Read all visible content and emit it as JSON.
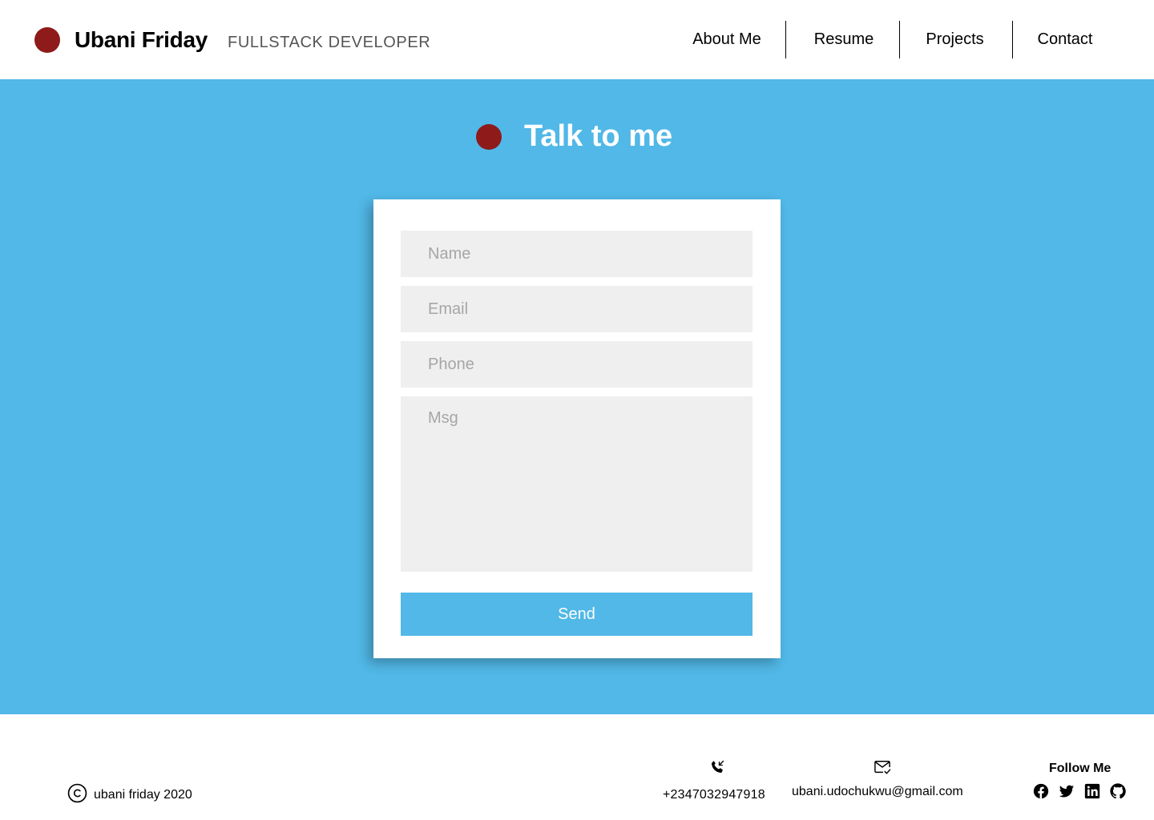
{
  "colors": {
    "accent_red": "#8e1a1a",
    "accent_blue": "#51b8e7"
  },
  "header": {
    "name": "Ubani Friday",
    "role": "FULLSTACK DEVELOPER",
    "nav": [
      {
        "label": "About Me"
      },
      {
        "label": "Resume"
      },
      {
        "label": "Projects"
      },
      {
        "label": "Contact"
      }
    ]
  },
  "contact_section": {
    "title": "Talk to me",
    "form": {
      "name_placeholder": "Name",
      "email_placeholder": "Email",
      "phone_placeholder": "Phone",
      "message_placeholder": "Msg",
      "send_label": "Send"
    }
  },
  "footer": {
    "copyright": "ubani friday 2020",
    "phone": "+2347032947918",
    "email": "ubani.udochukwu@gmail.com",
    "follow_label": "Follow Me",
    "social_icons": [
      "facebook-icon",
      "twitter-icon",
      "linkedin-icon",
      "github-icon"
    ]
  }
}
